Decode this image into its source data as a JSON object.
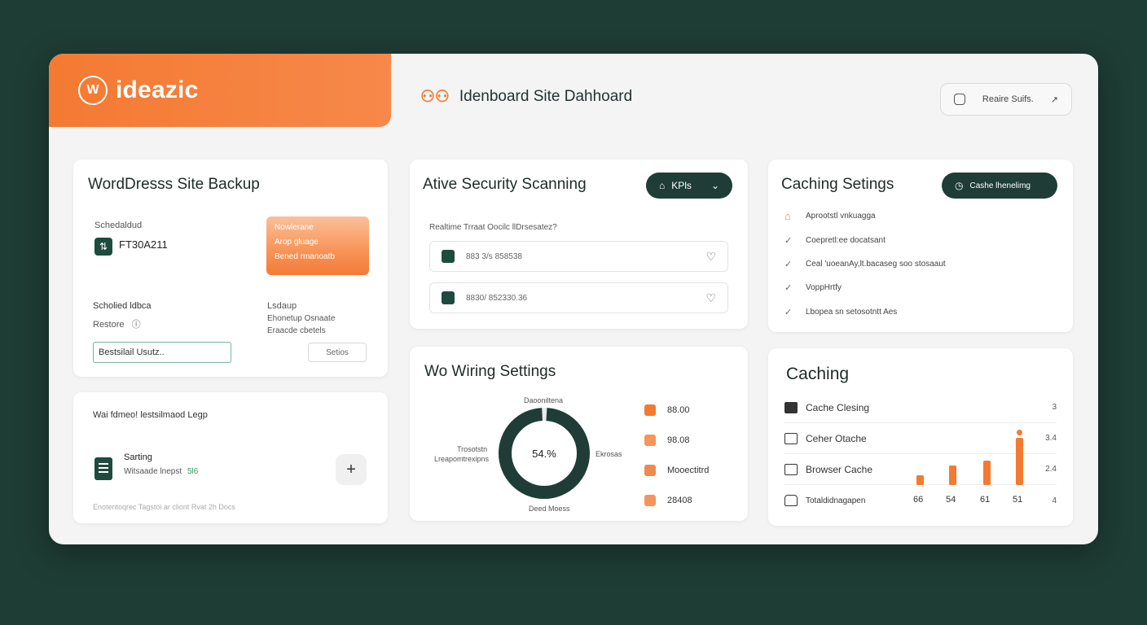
{
  "brand": {
    "logo_glyph": "W",
    "name": "ideazic"
  },
  "header": {
    "title": "Idenboard Site Dahhoard",
    "action_label": "Reaire Suifs.",
    "action_arrow": "↗"
  },
  "backup": {
    "title": "WordDresss Site Backup",
    "scheduled_label": "Schedaldud",
    "scheduled_value": "FT30A211",
    "tile_lines": [
      "Nowlerane",
      "Arop gluage",
      "Bened rmanoatb"
    ],
    "restore_label": "Scholied ldbca",
    "restore_sub": "Restore",
    "backup_label": "Lsdaup",
    "backup_sub1": "Ehonetup Osnaate",
    "backup_sub2": "Eraacde cbetels",
    "input_value": "Bestsilail Usutz..",
    "settings_btn": "Setios"
  },
  "legacy": {
    "title": "Wai fdmeo! lestsilmaod Legp",
    "item_title": "Sarting",
    "item_sub": "Witsaade lnepst",
    "item_badge": "5l6",
    "plus": "+",
    "footer": "Enotentoqrec Tagstoi ar cliont Rvat 2h Docs"
  },
  "security": {
    "title": "Ative Security Scanning",
    "kpi_label": "KPls",
    "subtitle": "Realtime Trraat Oocilc llDrsesatez?",
    "rows": [
      "883 3/s 858538",
      "8830/ 852330.36"
    ]
  },
  "wiring": {
    "title": "Wo Wiring Settings",
    "donut": {
      "value": 54,
      "display": "54.%",
      "top_label": "Daooniltena",
      "left_label1": "Trosotstn",
      "left_label2": "Lreapomtrexipns",
      "right_label": "Ekrosas",
      "bottom_label": "Deed Moess"
    },
    "legend": [
      "88.00",
      "98.08",
      "Mooectitrd",
      "28408"
    ]
  },
  "caching_settings": {
    "title": "Caching Setings",
    "btn_label": "Cashe lhenelimg",
    "items": [
      "Aprootstl vnkuagga",
      "Coepretl:ee docatsant",
      "Ceal 'uoeanAy,lt.bacaseg soo stosaaut",
      "VoppHrtfy",
      "Lbopea sn setosotntt Aes"
    ]
  },
  "caching": {
    "title": "Caching",
    "rows": [
      {
        "label": "Cache Clesing",
        "value": "3"
      },
      {
        "label": "Ceher Otache",
        "value": "3.4"
      },
      {
        "label": "Browser Cache",
        "value": "2.4"
      },
      {
        "label": "Totaldidnagapen",
        "value": "4"
      }
    ],
    "bar_labels": [
      "66",
      "54",
      "61",
      "51"
    ],
    "bar_values": [
      12,
      24,
      30,
      58
    ]
  }
}
